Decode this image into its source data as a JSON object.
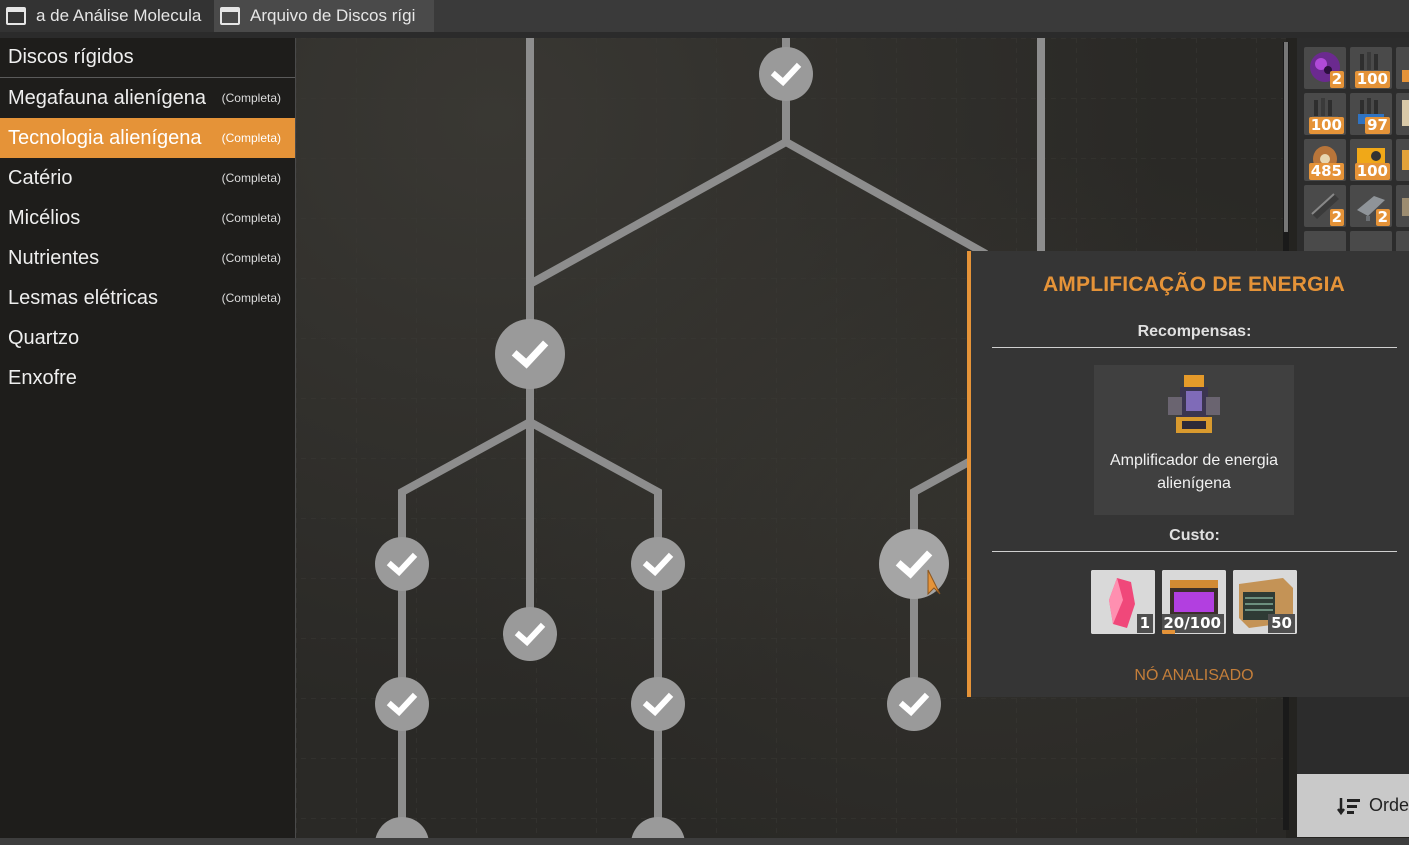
{
  "tabs": [
    {
      "label": "a de Análise Molecula"
    },
    {
      "label": "Arquivo de Discos rígi"
    }
  ],
  "sidebar": {
    "header": "Discos rígidos",
    "items": [
      {
        "label": "Megafauna alienígena",
        "status": "(Completa)"
      },
      {
        "label": "Tecnologia alienígena",
        "status": "(Completa)",
        "active": true
      },
      {
        "label": "Catério",
        "status": "(Completa)"
      },
      {
        "label": "Micélios",
        "status": "(Completa)"
      },
      {
        "label": "Nutrientes",
        "status": "(Completa)"
      },
      {
        "label": "Lesmas elétricas",
        "status": "(Completa)"
      },
      {
        "label": "Quartzo",
        "status": ""
      },
      {
        "label": "Enxofre",
        "status": ""
      }
    ]
  },
  "inventory": {
    "slots": [
      {
        "icon": "alien-orb-icon",
        "count": "2"
      },
      {
        "icon": "cable-bundle-icon",
        "count": "100"
      },
      {
        "icon": "partial-item-icon",
        "count": ""
      },
      {
        "icon": "cable-bundle-icon",
        "count": "100"
      },
      {
        "icon": "blue-cable-icon",
        "count": "97"
      },
      {
        "icon": "partial-item-icon",
        "count": ""
      },
      {
        "icon": "wire-spool-icon",
        "count": "485"
      },
      {
        "icon": "yellow-case-icon",
        "count": "100"
      },
      {
        "icon": "partial-item-icon",
        "count": ""
      },
      {
        "icon": "steel-pipe-icon",
        "count": "2"
      },
      {
        "icon": "steel-beam-icon",
        "count": "2"
      },
      {
        "icon": "partial-item-icon",
        "count": ""
      }
    ]
  },
  "order_button": {
    "label": "Orde",
    "icon": "sort-icon"
  },
  "tooltip": {
    "title": "AMPLIFICAÇÃO DE ENERGIA",
    "rewards_label": "Recompensas:",
    "reward_name": "Amplificador de energia alienígena",
    "cost_label": "Custo:",
    "costs": [
      {
        "icon": "pink-crystal-icon",
        "count": "1"
      },
      {
        "icon": "alien-power-cell-icon",
        "count": "20/100",
        "progress": 0.2
      },
      {
        "icon": "hard-drive-icon",
        "count": "50"
      }
    ],
    "status": "NÓ ANALISADO"
  },
  "colors": {
    "accent": "#e59338",
    "node": "#9a9a9a",
    "line": "#8d8d8d"
  }
}
